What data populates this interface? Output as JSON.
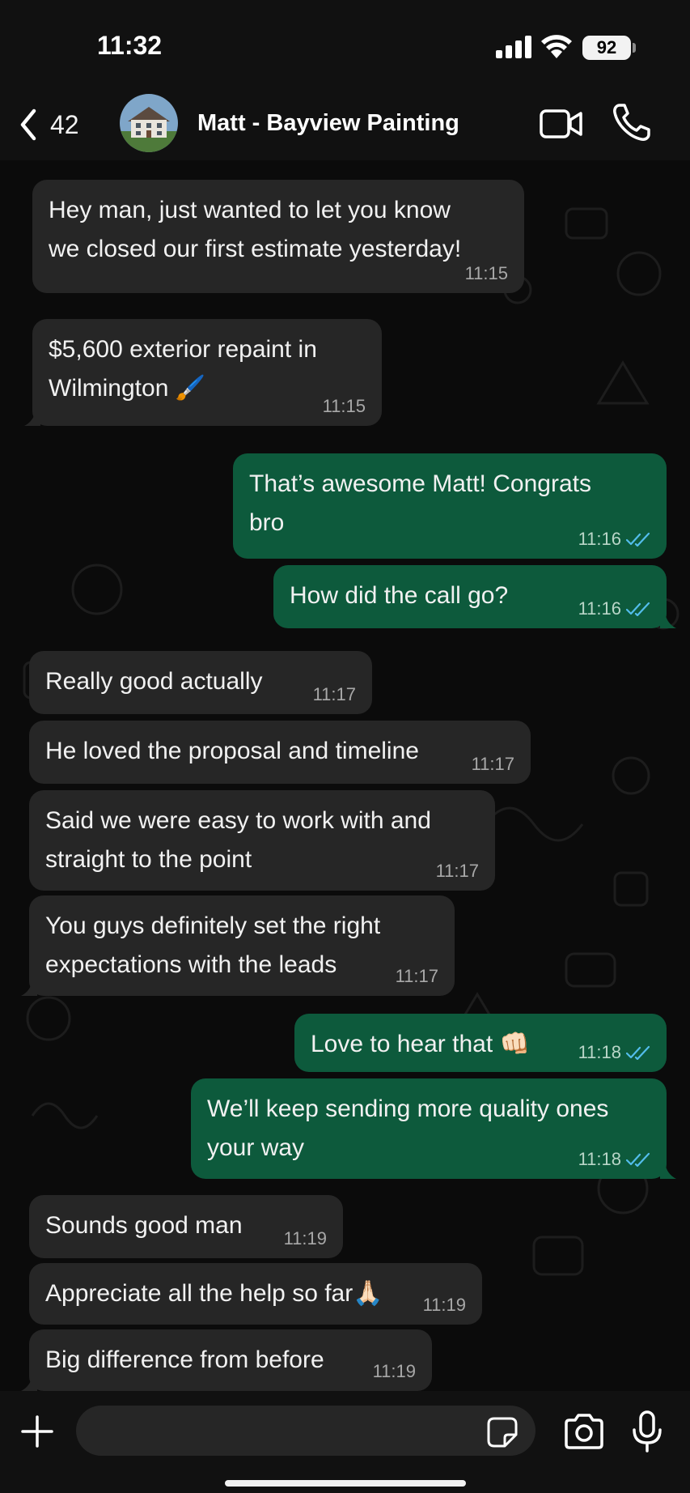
{
  "status_bar": {
    "time": "11:32",
    "battery": "92",
    "icons": [
      "signal-icon",
      "wifi-icon",
      "battery-icon"
    ]
  },
  "header": {
    "back_count": "42",
    "contact_name": "Matt - Bayview Painting",
    "icons": [
      "chevron-left-icon",
      "video-call-icon",
      "phone-icon"
    ]
  },
  "messages": [
    {
      "direction": "in",
      "lines": [
        "Hey man, just wanted to let you know",
        "we closed our first estimate yesterday!"
      ],
      "time": "11:15"
    },
    {
      "direction": "in",
      "lines": [
        "$5,600 exterior repaint in",
        "Wilmington 🖌️"
      ],
      "time": "11:15"
    },
    {
      "direction": "out",
      "lines": [
        "That’s awesome Matt! Congrats",
        "bro"
      ],
      "time": "11:16",
      "read": true
    },
    {
      "direction": "out",
      "lines": [
        "How did the call go?"
      ],
      "time": "11:16",
      "read": true
    },
    {
      "direction": "in",
      "lines": [
        "Really good actually"
      ],
      "time": "11:17"
    },
    {
      "direction": "in",
      "lines": [
        "He loved the proposal and timeline"
      ],
      "time": "11:17"
    },
    {
      "direction": "in",
      "lines": [
        "Said we were easy to work with and",
        "straight to the point"
      ],
      "time": "11:17"
    },
    {
      "direction": "in",
      "lines": [
        "You guys definitely set the right",
        "expectations with the leads"
      ],
      "time": "11:17"
    },
    {
      "direction": "out",
      "lines": [
        "Love to hear that 👊🏻"
      ],
      "time": "11:18",
      "read": true
    },
    {
      "direction": "out",
      "lines": [
        "We’ll keep sending more quality ones",
        "your way"
      ],
      "time": "11:18",
      "read": true
    },
    {
      "direction": "in",
      "lines": [
        "Sounds good man"
      ],
      "time": "11:19"
    },
    {
      "direction": "in",
      "lines": [
        "Appreciate all the help so far🙏🏻"
      ],
      "time": "11:19"
    },
    {
      "direction": "in",
      "lines": [
        "Big difference from before"
      ],
      "time": "11:19"
    }
  ],
  "input_bar": {
    "value": "",
    "placeholder": "",
    "icons": [
      "plus-icon",
      "sticker-icon",
      "camera-icon",
      "microphone-icon"
    ]
  },
  "colors": {
    "background": "#0b0b0b",
    "bar": "#111111",
    "incoming_bubble": "#262626",
    "outgoing_bubble": "#0d5a3c",
    "read_ticks": "#53bdeb"
  }
}
